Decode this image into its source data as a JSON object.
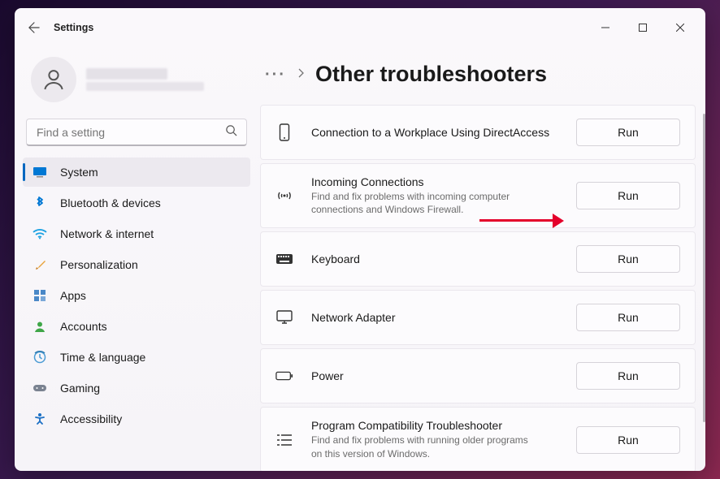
{
  "app_title": "Settings",
  "search": {
    "placeholder": "Find a setting"
  },
  "nav": {
    "items": [
      {
        "id": "system",
        "label": "System",
        "active": true
      },
      {
        "id": "bluetooth",
        "label": "Bluetooth & devices",
        "active": false
      },
      {
        "id": "network",
        "label": "Network & internet",
        "active": false
      },
      {
        "id": "personalization",
        "label": "Personalization",
        "active": false
      },
      {
        "id": "apps",
        "label": "Apps",
        "active": false
      },
      {
        "id": "accounts",
        "label": "Accounts",
        "active": false
      },
      {
        "id": "time",
        "label": "Time & language",
        "active": false
      },
      {
        "id": "gaming",
        "label": "Gaming",
        "active": false
      },
      {
        "id": "accessibility",
        "label": "Accessibility",
        "active": false
      }
    ]
  },
  "breadcrumb": {
    "crumb_more": "···",
    "page_title": "Other troubleshooters"
  },
  "run_label": "Run",
  "troubleshooters": [
    {
      "id": "directaccess",
      "title": "Connection to a Workplace Using DirectAccess",
      "desc": ""
    },
    {
      "id": "incoming",
      "title": "Incoming Connections",
      "desc": "Find and fix problems with incoming computer connections and Windows Firewall."
    },
    {
      "id": "keyboard",
      "title": "Keyboard",
      "desc": ""
    },
    {
      "id": "netadapter",
      "title": "Network Adapter",
      "desc": ""
    },
    {
      "id": "power",
      "title": "Power",
      "desc": ""
    },
    {
      "id": "compat",
      "title": "Program Compatibility Troubleshooter",
      "desc": "Find and fix problems with running older programs on this version of Windows."
    }
  ]
}
